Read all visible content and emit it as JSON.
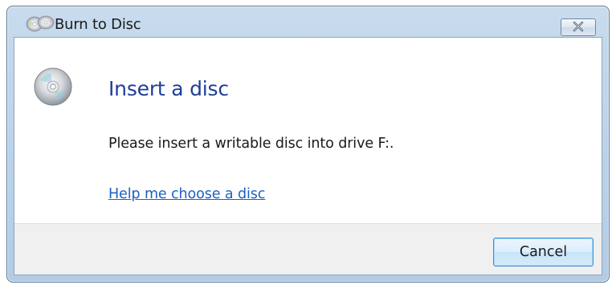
{
  "window": {
    "title": "Burn to Disc",
    "title_icon": "burn-disc-icon",
    "close_icon": "close-icon"
  },
  "content": {
    "icon": "cd-disc-icon",
    "heading": "Insert a disc",
    "message": "Please insert a writable disc into drive F:.",
    "help_link": "Help me choose a disc"
  },
  "footer": {
    "cancel_label": "Cancel"
  },
  "colors": {
    "heading": "#1e3f99",
    "link": "#1a61c4",
    "titlebar": "#bcd3ea",
    "footer_bg": "#f0f0f0",
    "button_border": "#3c8fd6"
  }
}
